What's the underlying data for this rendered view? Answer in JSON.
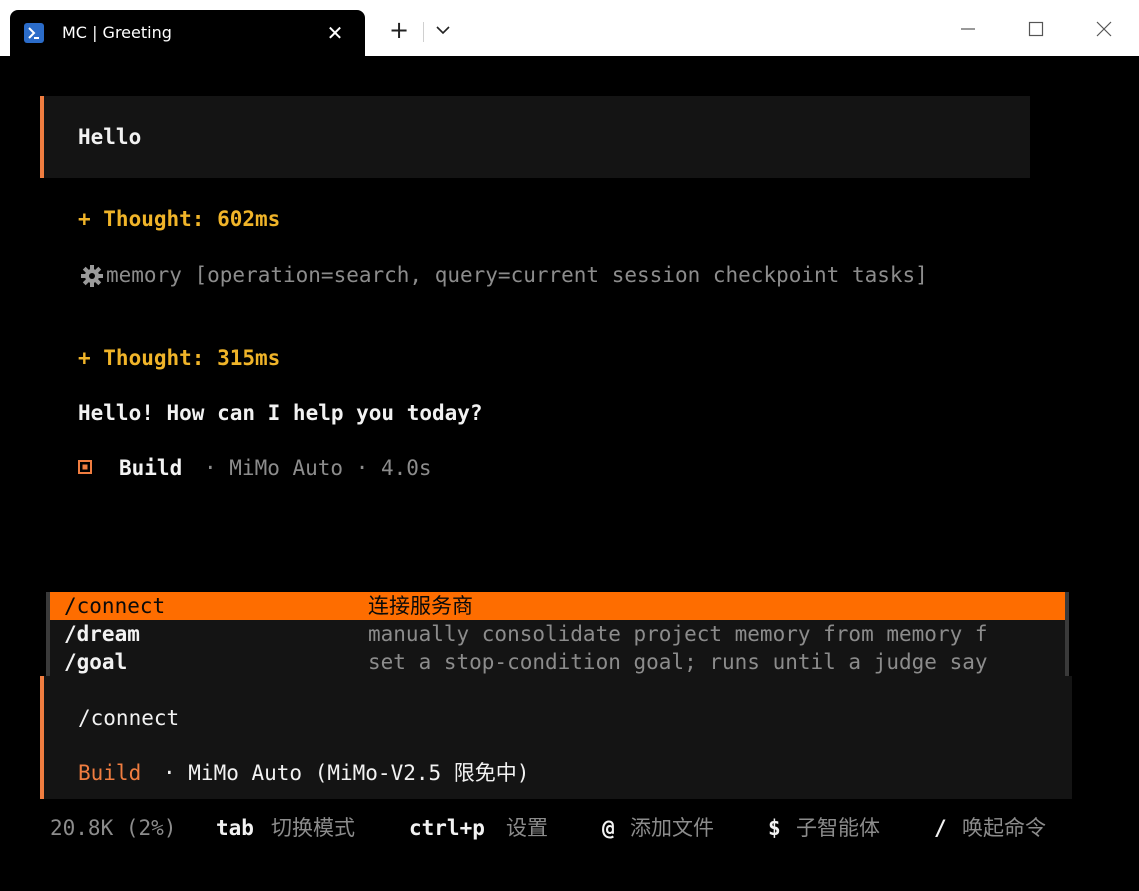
{
  "window": {
    "tab_title": "MC | Greeting",
    "close_tab": "✕",
    "new_tab": "+",
    "dropdown": "⌄"
  },
  "conversation": {
    "user_message": "Hello",
    "thought1": "+ Thought: 602ms",
    "tool_call": "memory [operation=search, query=current session checkpoint tasks]",
    "thought2": "+ Thought: 315ms",
    "reply": "Hello! How can I help you today?",
    "status_mode": "Build",
    "status_rest": "· MiMo Auto · 4.0s"
  },
  "commands": [
    {
      "cmd": "/connect",
      "desc": "连接服务商"
    },
    {
      "cmd": "/dream",
      "desc": "manually consolidate project memory from memory f"
    },
    {
      "cmd": "/goal",
      "desc": "set a stop-condition goal; runs until a judge say"
    }
  ],
  "input": {
    "value": "/connect",
    "mode": "Build",
    "model": "· MiMo Auto (MiMo-V2.5 限免中)"
  },
  "footer": {
    "tokens": "20.8K (2%)",
    "tab_key": "tab",
    "tab_label": "切换模式",
    "ctrlp_key": "ctrl+p",
    "ctrlp_label": "设置",
    "at_key": "@",
    "at_label": "添加文件",
    "dollar_key": "$",
    "dollar_label": "子智能体",
    "slash_key": "/",
    "slash_label": "唤起命令"
  },
  "colors": {
    "accent": "#f07d40",
    "selection": "#fe6d00",
    "thought": "#f0b429"
  }
}
